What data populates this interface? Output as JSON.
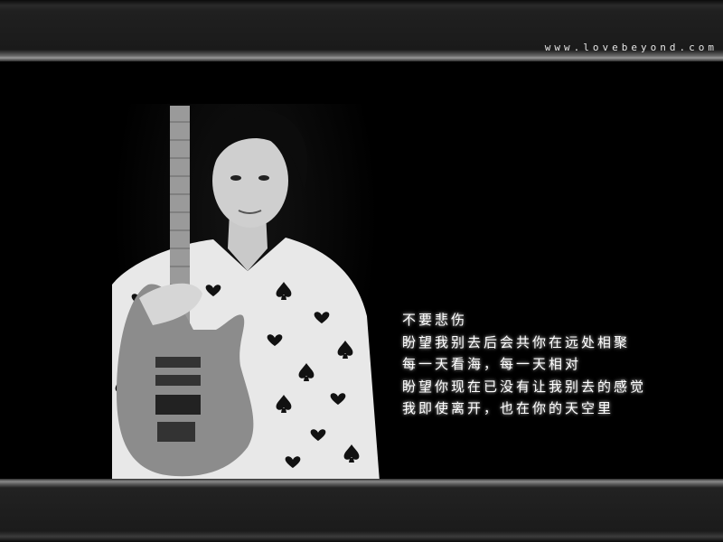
{
  "header": {
    "site_url": "www.lovebeyond.com"
  },
  "lyrics": [
    "不要悲伤",
    "盼望我别去后会共你在远处相聚",
    "每一天看海，每一天相对",
    "盼望你现在已没有让我别去的感觉",
    "我即使离开，也在你的天空里"
  ],
  "colors": {
    "background": "#000000",
    "bar": "#1a1a1a",
    "text": "#ffffff"
  }
}
